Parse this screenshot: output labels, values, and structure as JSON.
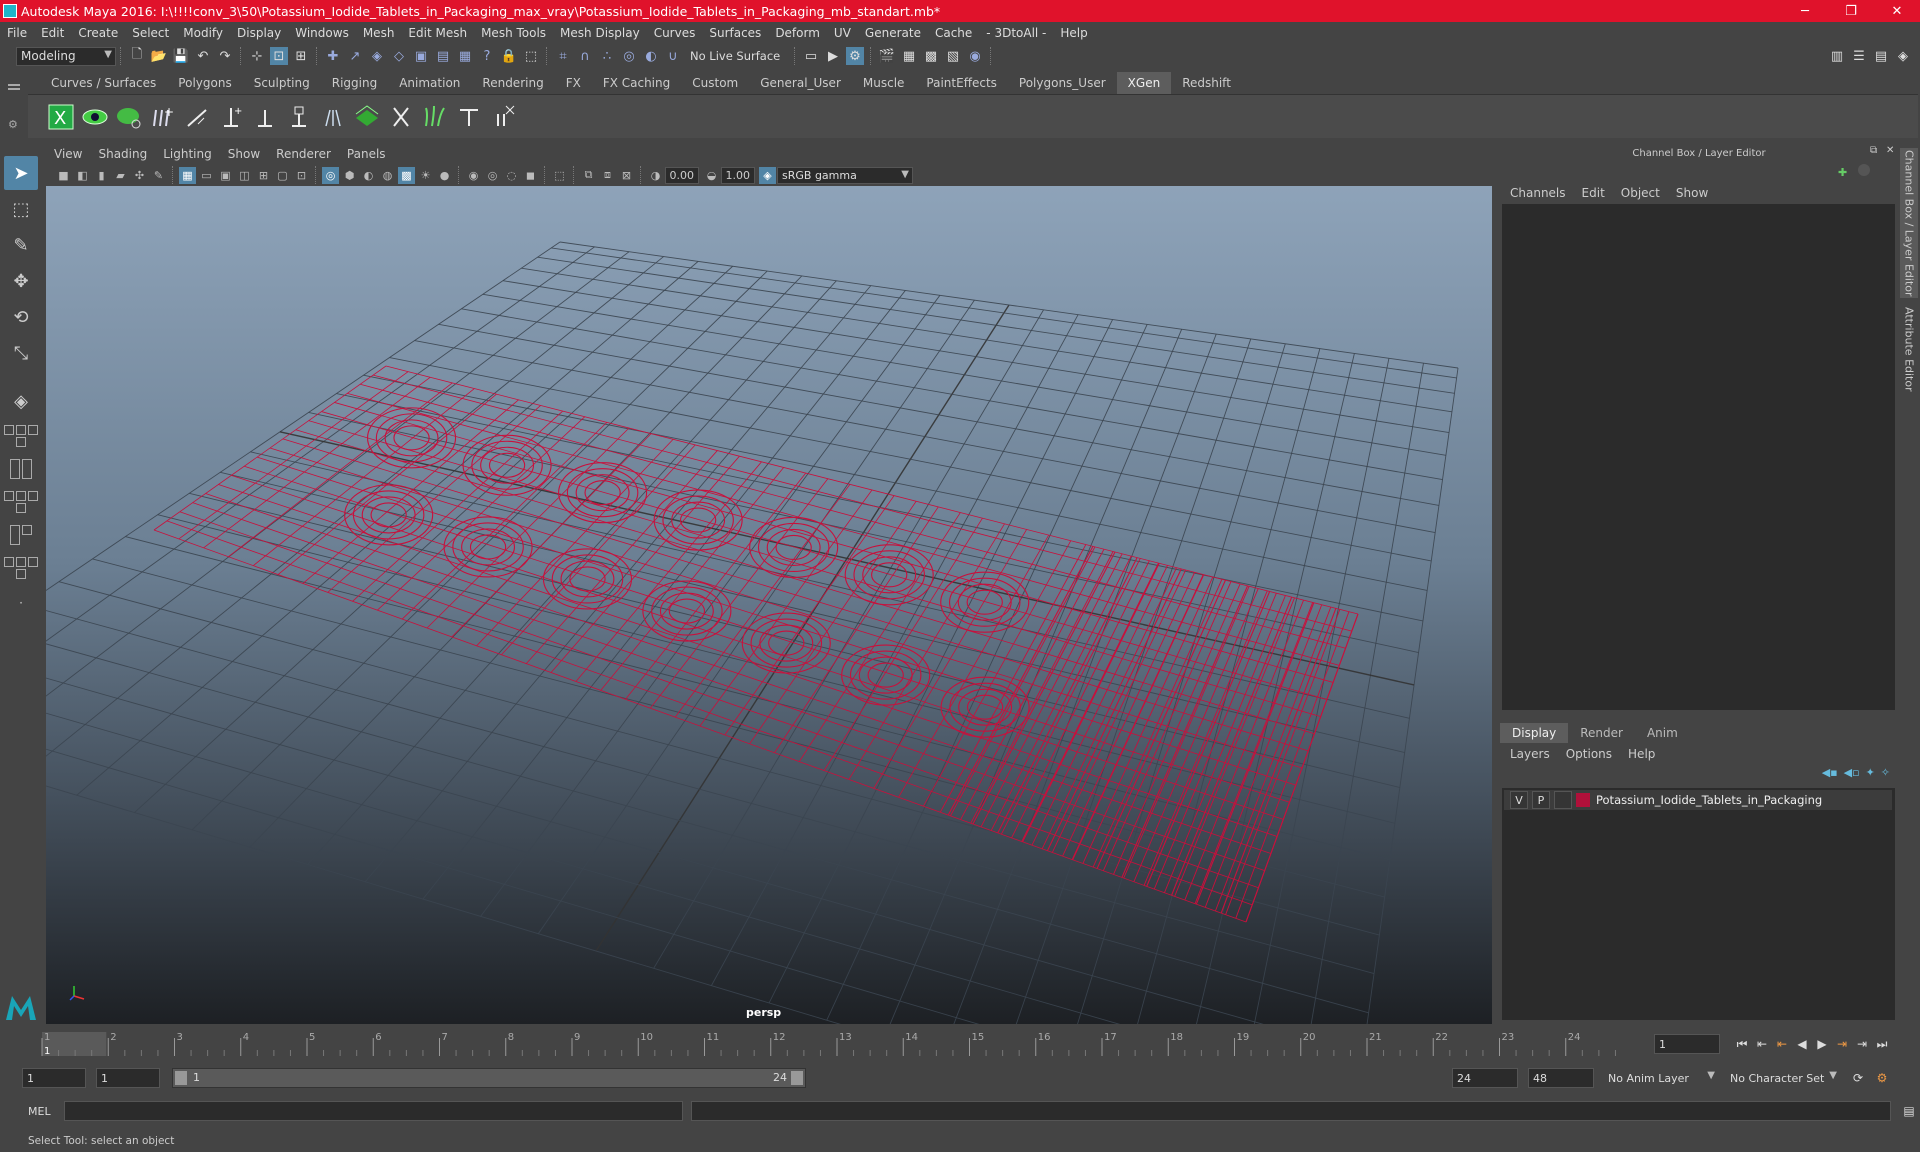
{
  "window": {
    "title": "Autodesk Maya 2016: I:\\!!!!conv_3\\50\\Potassium_Iodide_Tablets_in_Packaging_max_vray\\Potassium_Iodide_Tablets_in_Packaging_mb_standart.mb*",
    "minimize": "─",
    "restore": "❐",
    "close": "✕"
  },
  "menubar": [
    "File",
    "Edit",
    "Create",
    "Select",
    "Modify",
    "Display",
    "Windows",
    "Mesh",
    "Edit Mesh",
    "Mesh Tools",
    "Mesh Display",
    "Curves",
    "Surfaces",
    "Deform",
    "UV",
    "Generate",
    "Cache",
    "- 3DtoAll -",
    "Help"
  ],
  "statusline": {
    "mode": "Modeling",
    "live_surface": "No Live Surface"
  },
  "shelf_tabs": [
    "Curves / Surfaces",
    "Polygons",
    "Sculpting",
    "Rigging",
    "Animation",
    "Rendering",
    "FX",
    "FX Caching",
    "Custom",
    "General_User",
    "Muscle",
    "PaintEffects",
    "Polygons_User",
    "XGen",
    "Redshift"
  ],
  "shelf_active": "XGen",
  "viewport": {
    "menu": [
      "View",
      "Shading",
      "Lighting",
      "Show",
      "Renderer",
      "Panels"
    ],
    "exposure": "0.00",
    "gamma": "1.00",
    "color_space": "sRGB gamma",
    "camera_label": "persp"
  },
  "channel_box": {
    "title": "Channel Box / Layer Editor",
    "menu": [
      "Channels",
      "Edit",
      "Object",
      "Show"
    ]
  },
  "layer_editor": {
    "tabs": [
      "Display",
      "Render",
      "Anim"
    ],
    "active_tab": "Display",
    "menu": [
      "Layers",
      "Options",
      "Help"
    ],
    "layer": {
      "v": "V",
      "p": "P",
      "name": "Potassium_Iodide_Tablets_in_Packaging",
      "color": "#b0103a"
    }
  },
  "side_tabs": [
    "Channel Box / Layer Editor",
    "Attribute Editor"
  ],
  "timeline": {
    "ticks": [
      "1",
      "2",
      "3",
      "4",
      "5",
      "6",
      "7",
      "8",
      "9",
      "10",
      "11",
      "12",
      "13",
      "14",
      "15",
      "16",
      "17",
      "18",
      "19",
      "20",
      "21",
      "22",
      "23",
      "24"
    ],
    "current_frame": "1",
    "current_field": "1"
  },
  "range": {
    "start": "1",
    "playback_start": "1",
    "slider_start": "1",
    "slider_end": "24",
    "playback_end": "24",
    "end": "48",
    "anim_layer": "No Anim Layer",
    "character_set": "No Character Set"
  },
  "command_line": {
    "label": "MEL"
  },
  "help_line": "Select Tool: select an object",
  "colors": {
    "accent": "#5285a6",
    "title_bar": "#e0122b",
    "wireframe": "#c8103c"
  }
}
